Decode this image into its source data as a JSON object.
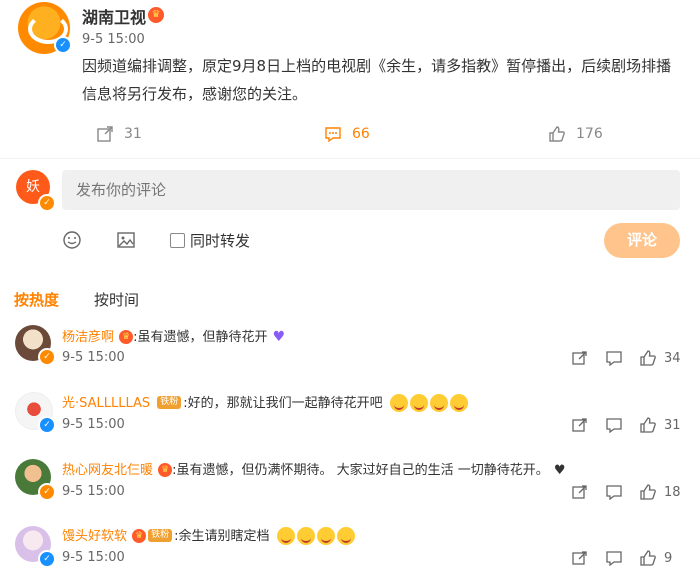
{
  "post": {
    "author": "湖南卫视",
    "time": "9-5 15:00",
    "text": "因频道编排调整，原定9月8日上档的电视剧《余生，请多指教》暂停播出，后续剧场排播信息将另行发布，感谢您的关注。",
    "reposts": "31",
    "comments": "66",
    "likes": "176"
  },
  "composer": {
    "placeholder": "发布你的评论",
    "repost_label": "同时转发",
    "submit_label": "评论"
  },
  "tabs": {
    "hot": "按热度",
    "time": "按时间"
  },
  "comments": [
    {
      "name": "杨洁彦啊",
      "text": ":虽有遗憾，但静待花开",
      "time": "9-5 15:00",
      "likes": "34"
    },
    {
      "name": "光·SALLLLLAS",
      "fan": "铁粉",
      "text": ":好的，那就让我们一起静待花开吧",
      "time": "9-5 15:00",
      "likes": "31"
    },
    {
      "name": "热心网友北仨暖",
      "text": ":虽有遗憾，但仍满怀期待。 大家过好自己的生活 一切静待花开。",
      "time": "9-5 15:00",
      "likes": "18"
    },
    {
      "name": "馒头好软软",
      "fan": "铁粉",
      "text": ":余生请别瞎定档",
      "time": "9-5 15:00",
      "likes": "9"
    }
  ],
  "colors": {
    "accent": "#ff8200",
    "verified": "#1890ff",
    "submit": "#ffc48c",
    "input_bg": "#f0f0f0"
  }
}
